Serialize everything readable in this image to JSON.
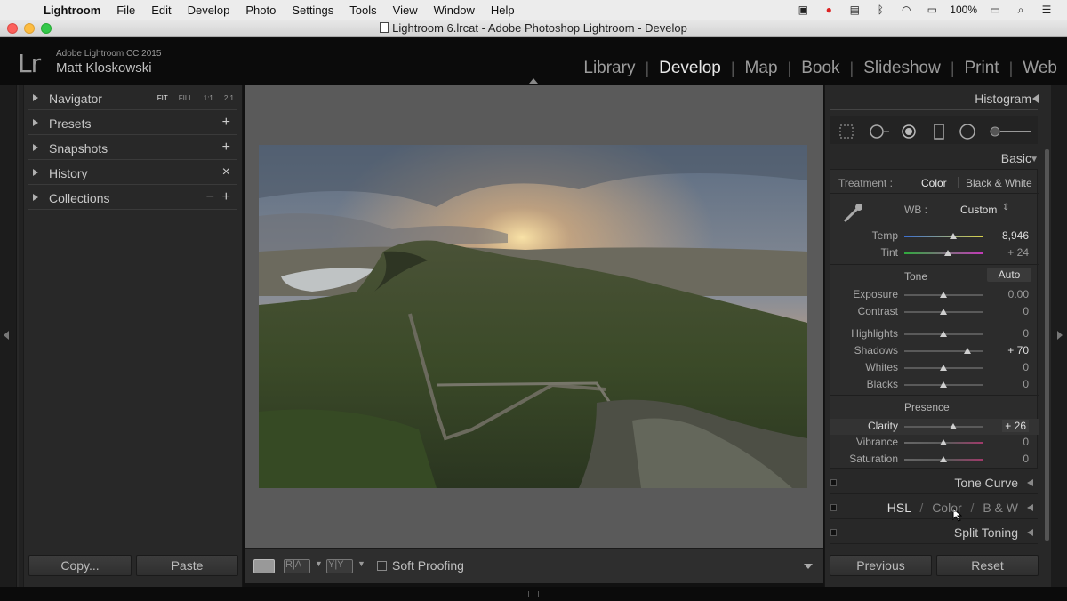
{
  "menubar": {
    "items": [
      "Lightroom",
      "File",
      "Edit",
      "Develop",
      "Photo",
      "Settings",
      "Tools",
      "View",
      "Window",
      "Help"
    ],
    "battery": "100%"
  },
  "window": {
    "title": "Lightroom 6.lrcat - Adobe Photoshop Lightroom - Develop"
  },
  "identity": {
    "logo": "Lr",
    "line1": "Adobe Lightroom CC 2015",
    "line2": "Matt Kloskowski"
  },
  "modules": [
    "Library",
    "Develop",
    "Map",
    "Book",
    "Slideshow",
    "Print",
    "Web"
  ],
  "active_module": "Develop",
  "left_panel": {
    "navigator": {
      "label": "Navigator",
      "zoom": [
        "FIT",
        "FILL",
        "1:1",
        "2:1"
      ]
    },
    "presets": {
      "label": "Presets",
      "action": "+"
    },
    "snapshots": {
      "label": "Snapshots",
      "action": "+"
    },
    "history": {
      "label": "History",
      "action": "×"
    },
    "collections": {
      "label": "Collections",
      "action_minus": "−",
      "action_plus": "+"
    },
    "copy_label": "Copy...",
    "paste_label": "Paste"
  },
  "toolbar": {
    "ra_label": "R|A",
    "yy_label": "Y|Y",
    "soft_proofing_label": "Soft Proofing"
  },
  "right_panel": {
    "histogram_label": "Histogram",
    "basic_label": "Basic",
    "treatment": {
      "label": "Treatment :",
      "color": "Color",
      "bw": "Black & White"
    },
    "wb": {
      "label": "WB :",
      "value": "Custom"
    },
    "tone_label": "Tone",
    "auto_label": "Auto",
    "presence_label": "Presence",
    "sliders": {
      "temp": {
        "label": "Temp",
        "value": "8,946",
        "position": 0.62
      },
      "tint": {
        "label": "Tint",
        "value": "+ 24",
        "position": 0.56
      },
      "exposure": {
        "label": "Exposure",
        "value": "0.00",
        "position": 0.5
      },
      "contrast": {
        "label": "Contrast",
        "value": "0",
        "position": 0.5
      },
      "highlights": {
        "label": "Highlights",
        "value": "0",
        "position": 0.5
      },
      "shadows": {
        "label": "Shadows",
        "value": "+ 70",
        "position": 0.81
      },
      "whites": {
        "label": "Whites",
        "value": "0",
        "position": 0.5
      },
      "blacks": {
        "label": "Blacks",
        "value": "0",
        "position": 0.5
      },
      "clarity": {
        "label": "Clarity",
        "value": "+ 26",
        "position": 0.63
      },
      "vibrance": {
        "label": "Vibrance",
        "value": "0",
        "position": 0.5
      },
      "saturation": {
        "label": "Saturation",
        "value": "0",
        "position": 0.5
      }
    },
    "tone_curve_label": "Tone Curve",
    "hsl": {
      "hsl": "HSL",
      "color": "Color",
      "bw": "B & W",
      "sep": "/"
    },
    "split_toning_label": "Split Toning",
    "previous_label": "Previous",
    "reset_label": "Reset"
  },
  "colors": {
    "panel": "#282828",
    "canvas": "#5a5a5a",
    "active_module": "#e8e8e8"
  }
}
